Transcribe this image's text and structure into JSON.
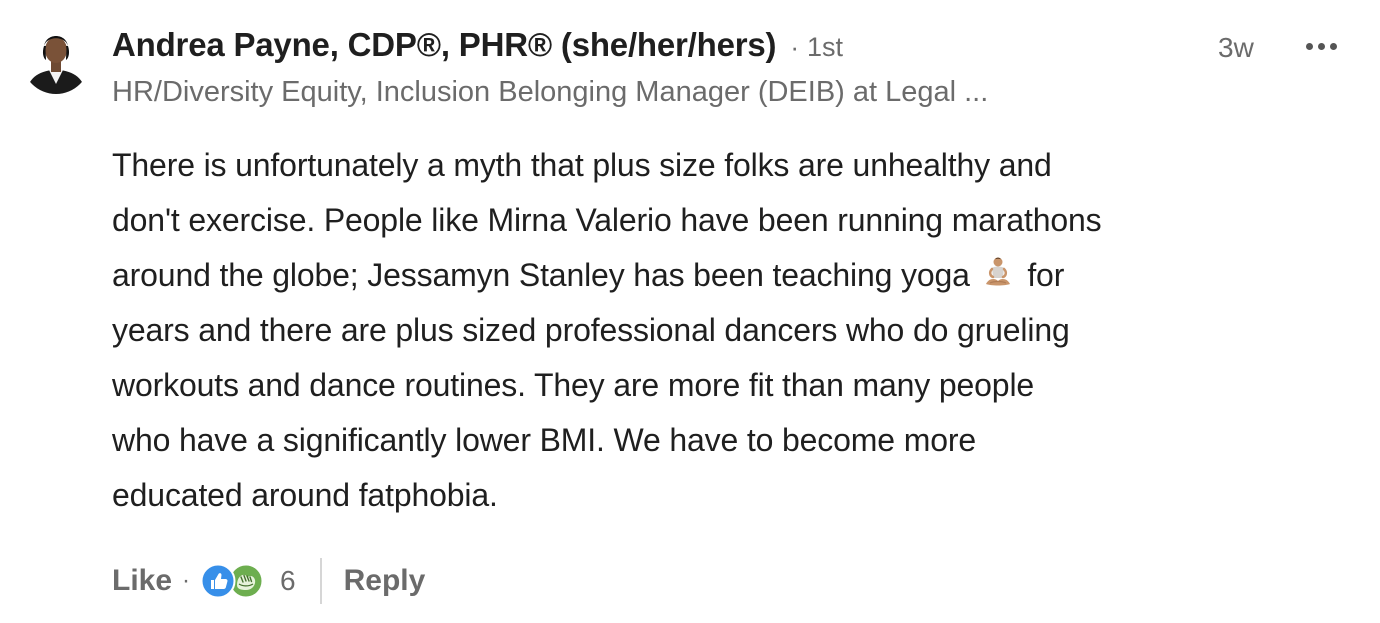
{
  "comment": {
    "author": {
      "name": "Andrea Payne, CDP®, PHR® (she/her/hers)",
      "connection_separator": "·",
      "connection_degree": "1st",
      "headline": "HR/Diversity Equity, Inclusion Belonging Manager (DEIB) at Legal ..."
    },
    "timestamp": "3w",
    "body": {
      "line1": "There is unfortunately a myth that plus size folks are unhealthy and",
      "line2": "don't exercise. People like Mirna Valerio have been running marathons",
      "line3_before_emoji": "around the globe; Jessamyn Stanley has been teaching yoga",
      "line3_after_emoji": "for",
      "line4": "years and there are plus sized professional dancers who do grueling",
      "line5": "workouts and dance routines. They are more fit than many people",
      "line6": "who have a significantly lower BMI. We have to become more",
      "line7": "educated around fatphobia."
    },
    "inline_emoji": "yoga-person-icon",
    "actions": {
      "like_label": "Like",
      "separator": "·",
      "reaction_icons": [
        "like-reaction-icon",
        "celebrate-reaction-icon"
      ],
      "reaction_count": "6",
      "reply_label": "Reply"
    }
  },
  "colors": {
    "text_primary": "#1f1f1f",
    "text_secondary": "#6b6b6b",
    "like_blue": "#378fe9",
    "celebrate_green": "#44712e",
    "divider": "#d6d6d6"
  }
}
